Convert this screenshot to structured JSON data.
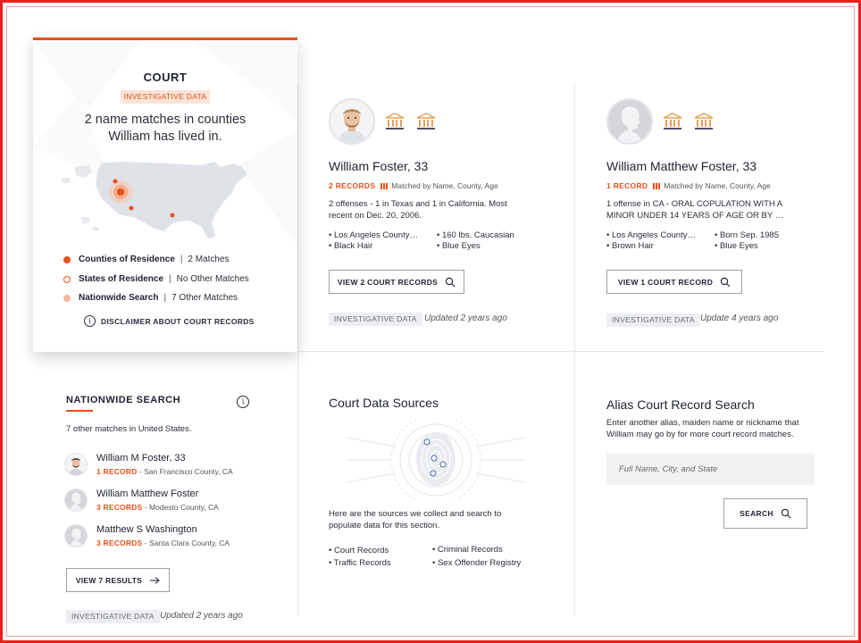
{
  "summary": {
    "title": "COURT",
    "tag": "INVESTIGATIVE DATA",
    "headline_line1": "2 name matches in counties",
    "headline_line2": "William has lived in.",
    "legend": [
      {
        "name": "Counties of Residence",
        "value": "2 Matches"
      },
      {
        "name": "States of Residence",
        "value": "No Other Matches"
      },
      {
        "name": "Nationwide Search",
        "value": "7 Other Matches"
      }
    ],
    "disclaimer": "DISCLAIMER ABOUT COURT RECORDS"
  },
  "persons": [
    {
      "name": "William Foster, 33",
      "records": "2 RECORDS",
      "match": "Matched by Name, County, Age",
      "desc_line1": "2 offenses - 1 in Texas and 1 in California. Most",
      "desc_line2": "recent on Dec. 20, 2006.",
      "attrs": [
        "Los Angeles County…",
        "160 lbs. Caucasian",
        "Black Hair",
        "Blue Eyes"
      ],
      "button": "VIEW 2 COURT RECORDS",
      "tag": "INVESTIGATIVE DATA",
      "updated": "Updated 2 years ago"
    },
    {
      "name": "William Matthew Foster, 33",
      "records": "1 RECORD",
      "match": "Matched by Name, County, Age",
      "desc_line1": "1 offense in CA - ORAL COPULATION WITH A",
      "desc_line2": "MINOR UNDER 14 YEARS OF AGE OR BY …",
      "attrs": [
        "Los Angeles County…",
        "Born Sep. 1985",
        "Brown Hair",
        "Blue Eyes"
      ],
      "button": "VIEW 1 COURT RECORD",
      "tag": "INVESTIGATIVE DATA",
      "updated": "Update 4 years ago"
    }
  ],
  "nationwide": {
    "title": "NATIONWIDE SEARCH",
    "subtitle": "7 other matches in United States.",
    "rows": [
      {
        "name": "William M Foster, 33",
        "records": "1 RECORD",
        "location": "San Francisco County, CA"
      },
      {
        "name": "William Matthew Foster",
        "records": "3 RECORDS",
        "location": "Modesto County, CA"
      },
      {
        "name": "Matthew S Washington",
        "records": "3 RECORDS",
        "location": "Santa Clara County, CA"
      }
    ],
    "button": "VIEW 7 RESULTS",
    "tag": "INVESTIGATIVE DATA",
    "updated": "Updated 2 years ago"
  },
  "sources": {
    "title": "Court Data Sources",
    "text_line1": "Here are the sources we collect and search to",
    "text_line2": "populate data for this section.",
    "items": [
      "Court Records",
      "Criminal Records",
      "Traffic  Records",
      "Sex Offender Registry"
    ]
  },
  "alias": {
    "title": "Alias Court Record Search",
    "text_line1": "Enter another alias, maiden name or nickname that",
    "text_line2": "William may go by for more court record matches.",
    "placeholder": "Full Name, City, and State",
    "button": "SEARCH"
  },
  "colors": {
    "accent": "#e8501c",
    "frame": "#e8201c",
    "tag_bg": "#fbe3d6"
  },
  "icons": [
    "info-icon",
    "courthouse-icon",
    "magnifier-icon",
    "arrow-right-icon",
    "fingerprint-icon",
    "us-map-icon"
  ]
}
